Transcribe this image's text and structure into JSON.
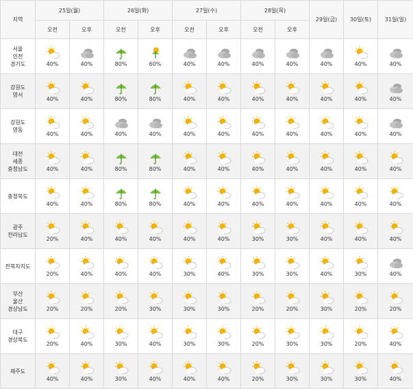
{
  "header": {
    "region_label": "지역",
    "days": [
      {
        "label": "25일(월)",
        "split": true
      },
      {
        "label": "26일(화)",
        "split": true
      },
      {
        "label": "27일(수)",
        "split": true
      },
      {
        "label": "28일(목)",
        "split": true
      },
      {
        "label": "29일(금)",
        "split": false
      },
      {
        "label": "30일(토)",
        "split": false
      },
      {
        "label": "31일(일)",
        "split": false
      }
    ],
    "am": "오전",
    "pm": "오후"
  },
  "icons": {
    "partly_cloudy": "partly-cloudy-icon",
    "cloudy": "cloudy-icon",
    "rain": "umbrella-icon",
    "shower": "shower-icon"
  },
  "colors": {
    "sun": "#f2b400",
    "cloud": "#bdbdbd",
    "umbrella": "#7ac143"
  },
  "rows": [
    {
      "region": [
        "서울",
        "인천",
        "경기도"
      ],
      "cells": [
        {
          "icon": "partly_cloudy",
          "pct": "40%"
        },
        {
          "icon": "cloudy",
          "pct": "40%"
        },
        {
          "icon": "rain",
          "pct": "80%"
        },
        {
          "icon": "shower",
          "pct": "60%"
        },
        {
          "icon": "cloudy",
          "pct": "40%"
        },
        {
          "icon": "cloudy",
          "pct": "40%"
        },
        {
          "icon": "cloudy",
          "pct": "40%"
        },
        {
          "icon": "cloudy",
          "pct": "40%"
        },
        {
          "icon": "cloudy",
          "pct": "40%"
        },
        {
          "icon": "partly_cloudy",
          "pct": "40%"
        },
        {
          "icon": "cloudy",
          "pct": "40%"
        }
      ]
    },
    {
      "region": [
        "강원도",
        "영서"
      ],
      "cells": [
        {
          "icon": "partly_cloudy",
          "pct": "40%"
        },
        {
          "icon": "partly_cloudy",
          "pct": "40%"
        },
        {
          "icon": "rain",
          "pct": "80%"
        },
        {
          "icon": "rain",
          "pct": "80%"
        },
        {
          "icon": "partly_cloudy",
          "pct": "40%"
        },
        {
          "icon": "partly_cloudy",
          "pct": "40%"
        },
        {
          "icon": "partly_cloudy",
          "pct": "40%"
        },
        {
          "icon": "partly_cloudy",
          "pct": "40%"
        },
        {
          "icon": "partly_cloudy",
          "pct": "40%"
        },
        {
          "icon": "partly_cloudy",
          "pct": "40%"
        },
        {
          "icon": "cloudy",
          "pct": "40%"
        }
      ]
    },
    {
      "region": [
        "강원도",
        "영동"
      ],
      "cells": [
        {
          "icon": "partly_cloudy",
          "pct": "40%"
        },
        {
          "icon": "partly_cloudy",
          "pct": "40%"
        },
        {
          "icon": "cloudy",
          "pct": "40%"
        },
        {
          "icon": "cloudy",
          "pct": "40%"
        },
        {
          "icon": "partly_cloudy",
          "pct": "40%"
        },
        {
          "icon": "partly_cloudy",
          "pct": "40%"
        },
        {
          "icon": "partly_cloudy",
          "pct": "40%"
        },
        {
          "icon": "partly_cloudy",
          "pct": "40%"
        },
        {
          "icon": "partly_cloudy",
          "pct": "40%"
        },
        {
          "icon": "partly_cloudy",
          "pct": "40%"
        },
        {
          "icon": "cloudy",
          "pct": "40%"
        }
      ]
    },
    {
      "region": [
        "대전",
        "세종",
        "충청남도"
      ],
      "cells": [
        {
          "icon": "partly_cloudy",
          "pct": "40%"
        },
        {
          "icon": "partly_cloudy",
          "pct": "40%"
        },
        {
          "icon": "rain",
          "pct": "80%"
        },
        {
          "icon": "rain",
          "pct": "80%"
        },
        {
          "icon": "partly_cloudy",
          "pct": "40%"
        },
        {
          "icon": "partly_cloudy",
          "pct": "40%"
        },
        {
          "icon": "partly_cloudy",
          "pct": "40%"
        },
        {
          "icon": "partly_cloudy",
          "pct": "40%"
        },
        {
          "icon": "partly_cloudy",
          "pct": "40%"
        },
        {
          "icon": "partly_cloudy",
          "pct": "40%"
        },
        {
          "icon": "partly_cloudy",
          "pct": "40%"
        }
      ]
    },
    {
      "region": [
        "충청북도"
      ],
      "cells": [
        {
          "icon": "partly_cloudy",
          "pct": "40%"
        },
        {
          "icon": "partly_cloudy",
          "pct": "40%"
        },
        {
          "icon": "rain",
          "pct": "80%"
        },
        {
          "icon": "rain",
          "pct": "80%"
        },
        {
          "icon": "partly_cloudy",
          "pct": "40%"
        },
        {
          "icon": "partly_cloudy",
          "pct": "40%"
        },
        {
          "icon": "partly_cloudy",
          "pct": "40%"
        },
        {
          "icon": "partly_cloudy",
          "pct": "40%"
        },
        {
          "icon": "partly_cloudy",
          "pct": "40%"
        },
        {
          "icon": "partly_cloudy",
          "pct": "40%"
        },
        {
          "icon": "partly_cloudy",
          "pct": "40%"
        }
      ]
    },
    {
      "region": [
        "광주",
        "전라남도"
      ],
      "cells": [
        {
          "icon": "partly_cloudy",
          "pct": "20%"
        },
        {
          "icon": "partly_cloudy",
          "pct": "40%"
        },
        {
          "icon": "partly_cloudy",
          "pct": "40%"
        },
        {
          "icon": "partly_cloudy",
          "pct": "40%"
        },
        {
          "icon": "partly_cloudy",
          "pct": "40%"
        },
        {
          "icon": "partly_cloudy",
          "pct": "40%"
        },
        {
          "icon": "partly_cloudy",
          "pct": "30%"
        },
        {
          "icon": "partly_cloudy",
          "pct": "30%"
        },
        {
          "icon": "partly_cloudy",
          "pct": "40%"
        },
        {
          "icon": "partly_cloudy",
          "pct": "40%"
        },
        {
          "icon": "partly_cloudy",
          "pct": "40%"
        }
      ]
    },
    {
      "region": [
        "전북자치도"
      ],
      "cells": [
        {
          "icon": "partly_cloudy",
          "pct": "20%"
        },
        {
          "icon": "partly_cloudy",
          "pct": "40%"
        },
        {
          "icon": "partly_cloudy",
          "pct": "40%"
        },
        {
          "icon": "partly_cloudy",
          "pct": "40%"
        },
        {
          "icon": "partly_cloudy",
          "pct": "30%"
        },
        {
          "icon": "partly_cloudy",
          "pct": "40%"
        },
        {
          "icon": "partly_cloudy",
          "pct": "30%"
        },
        {
          "icon": "partly_cloudy",
          "pct": "30%"
        },
        {
          "icon": "partly_cloudy",
          "pct": "40%"
        },
        {
          "icon": "partly_cloudy",
          "pct": "30%"
        },
        {
          "icon": "cloudy",
          "pct": "40%"
        }
      ]
    },
    {
      "region": [
        "부산",
        "울산",
        "경상남도"
      ],
      "cells": [
        {
          "icon": "partly_cloudy",
          "pct": "20%"
        },
        {
          "icon": "partly_cloudy",
          "pct": "20%"
        },
        {
          "icon": "partly_cloudy",
          "pct": "20%"
        },
        {
          "icon": "partly_cloudy",
          "pct": "30%"
        },
        {
          "icon": "partly_cloudy",
          "pct": "30%"
        },
        {
          "icon": "partly_cloudy",
          "pct": "30%"
        },
        {
          "icon": "partly_cloudy",
          "pct": "20%"
        },
        {
          "icon": "partly_cloudy",
          "pct": "20%"
        },
        {
          "icon": "partly_cloudy",
          "pct": "30%"
        },
        {
          "icon": "partly_cloudy",
          "pct": "20%"
        },
        {
          "icon": "partly_cloudy",
          "pct": "20%"
        }
      ]
    },
    {
      "region": [
        "대구",
        "경상북도"
      ],
      "cells": [
        {
          "icon": "partly_cloudy",
          "pct": "20%"
        },
        {
          "icon": "partly_cloudy",
          "pct": "40%"
        },
        {
          "icon": "partly_cloudy",
          "pct": "30%"
        },
        {
          "icon": "partly_cloudy",
          "pct": "40%"
        },
        {
          "icon": "partly_cloudy",
          "pct": "30%"
        },
        {
          "icon": "partly_cloudy",
          "pct": "30%"
        },
        {
          "icon": "partly_cloudy",
          "pct": "20%"
        },
        {
          "icon": "partly_cloudy",
          "pct": "30%"
        },
        {
          "icon": "partly_cloudy",
          "pct": "30%"
        },
        {
          "icon": "partly_cloudy",
          "pct": "20%"
        },
        {
          "icon": "partly_cloudy",
          "pct": "40%"
        }
      ]
    },
    {
      "region": [
        "제주도"
      ],
      "cells": [
        {
          "icon": "partly_cloudy",
          "pct": "40%"
        },
        {
          "icon": "partly_cloudy",
          "pct": "40%"
        },
        {
          "icon": "partly_cloudy",
          "pct": "30%"
        },
        {
          "icon": "partly_cloudy",
          "pct": "40%"
        },
        {
          "icon": "partly_cloudy",
          "pct": "40%"
        },
        {
          "icon": "partly_cloudy",
          "pct": "40%"
        },
        {
          "icon": "partly_cloudy",
          "pct": "20%"
        },
        {
          "icon": "partly_cloudy",
          "pct": "30%"
        },
        {
          "icon": "partly_cloudy",
          "pct": "30%"
        },
        {
          "icon": "partly_cloudy",
          "pct": "30%"
        },
        {
          "icon": "partly_cloudy",
          "pct": "40%"
        }
      ]
    }
  ]
}
